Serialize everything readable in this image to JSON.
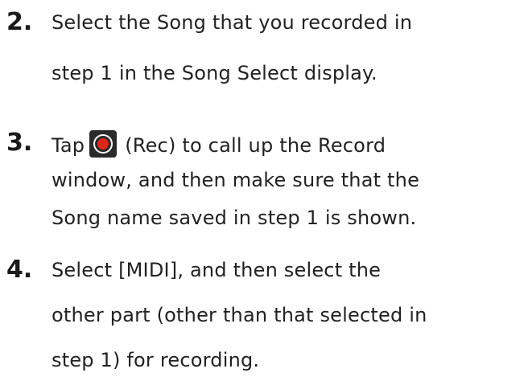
{
  "steps": [
    {
      "number": "2.",
      "lines": [
        "Select the Song that you recorded in",
        "step 1 in the Song Select display."
      ]
    },
    {
      "number": "3.",
      "lines": [
        "Tap",
        "(Rec) to call up the Record",
        "window, and then make sure that the",
        "Song name saved in step 1 is shown."
      ],
      "icon": "record-icon"
    },
    {
      "number": "4.",
      "lines": [
        "Select [MIDI], and then select the",
        "other part (other than that selected in",
        "step 1) for recording."
      ]
    }
  ],
  "colors": {
    "record_red": "#e0261b",
    "icon_bg": "#2a2a2a"
  }
}
